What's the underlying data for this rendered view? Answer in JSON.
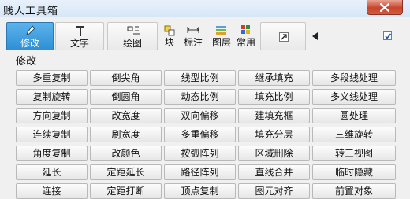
{
  "window": {
    "title": "贱人工具箱"
  },
  "toolbar": {
    "buttons": [
      {
        "id": "modify",
        "label": "修改",
        "icon": "pen-icon",
        "active": true
      },
      {
        "id": "text",
        "label": "文字",
        "icon": "text-t-icon"
      },
      {
        "id": "draw",
        "label": "绘图",
        "icon": "draw-icon"
      },
      {
        "id": "block",
        "label": "块",
        "icon": "block-icon"
      },
      {
        "id": "dimension",
        "label": "标注",
        "icon": "dimension-icon"
      },
      {
        "id": "layer",
        "label": "图层",
        "icon": "layer-icon"
      },
      {
        "id": "common",
        "label": "常用",
        "icon": "grid-icon"
      },
      {
        "id": "expand",
        "label": "",
        "icon": "arrow-diagonal-icon"
      },
      {
        "id": "collapse",
        "label": "",
        "icon": "triangle-left-icon"
      }
    ],
    "pin_checked": true
  },
  "section": {
    "label": "修改"
  },
  "commands": [
    "多重复制",
    "倒尖角",
    "线型比例",
    "继承填充",
    "多段线处理",
    "复制旋转",
    "倒圆角",
    "动态比例",
    "填充比例",
    "多义线处理",
    "方向复制",
    "改宽度",
    "双向偏移",
    "建填充框",
    "圆处理",
    "连续复制",
    "刷宽度",
    "多重偏移",
    "填充分层",
    "三维旋转",
    "角度复制",
    "改颜色",
    "按弧阵列",
    "区域删除",
    "转三视图",
    "延长",
    "定距延长",
    "路径阵列",
    "直线合并",
    "临时隐藏",
    "连接",
    "定距打断",
    "顶点复制",
    "图元对齐",
    "前置对象"
  ],
  "colors": {
    "active_tab": "#3a9be0",
    "close_button": "#c7442b"
  }
}
